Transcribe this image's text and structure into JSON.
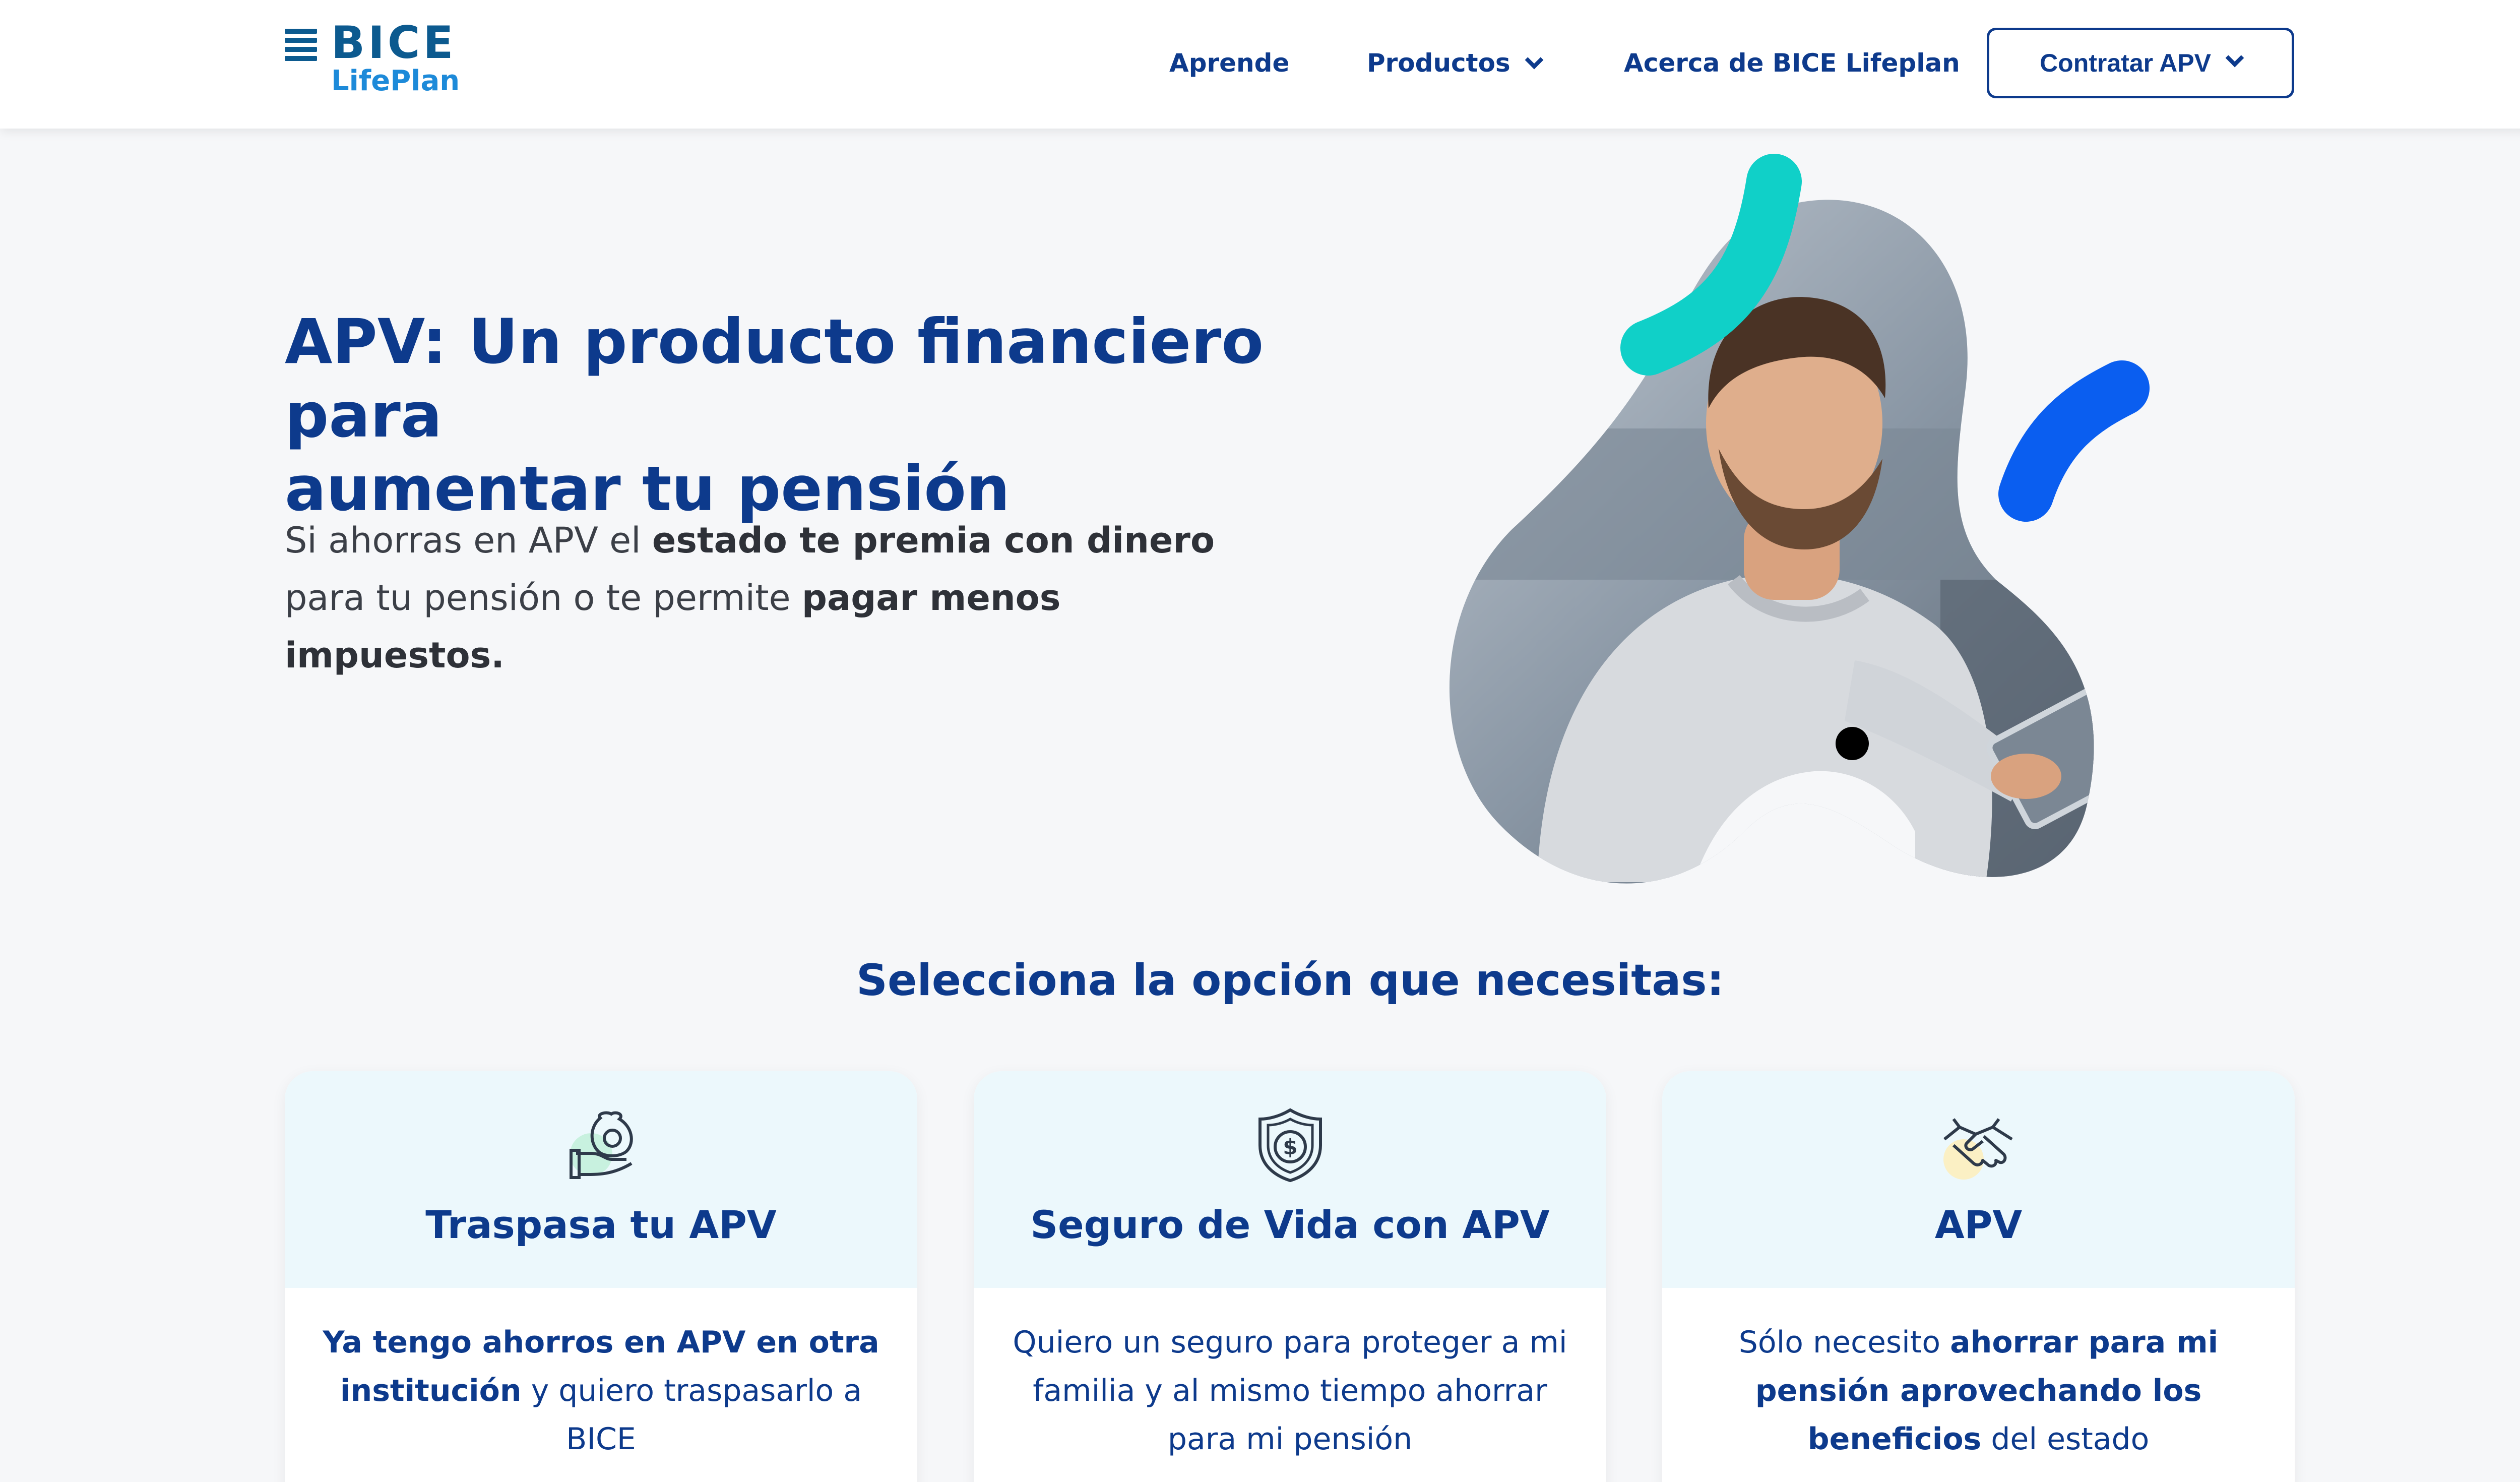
{
  "nav": {
    "logo_top": "BICE",
    "logo_bottom": "LifePlan",
    "links": [
      "Aprende",
      "Productos",
      "Acerca de BICE Lifeplan"
    ],
    "cta": "Contratar APV"
  },
  "hero": {
    "title_strong": "APV:",
    "title_light": " Un producto financiero para",
    "title_line2": "aumentar tu pensión",
    "text_1": "Si ahorras en APV el ",
    "text_b1": "estado te premia con dinero",
    "text_2": " para tu pensión o te permite ",
    "text_b2": "pagar menos impuestos."
  },
  "section": {
    "title": "Selecciona la opción que necesitas:"
  },
  "cards": [
    {
      "title": "Traspasa tu APV",
      "icon": "money-bag-hand-icon",
      "text_b": "Ya tengo ahorros en APV en otra institución",
      "text": " y quiero traspasarlo a BICE"
    },
    {
      "title": "Seguro de Vida con APV",
      "icon": "shield-dollar-icon",
      "text": "Quiero un seguro para proteger a mi familia y al mismo tiempo ahorrar para mi pensión"
    },
    {
      "title": "APV",
      "icon": "handshake-icon",
      "text_1": "Sólo necesito ",
      "text_b": "ahorrar para mi pensión aprovechando los beneficios",
      "text_2": " del estado"
    }
  ],
  "colors": {
    "primary": "#0d3a8c",
    "teal": "#10d0c8",
    "blue": "#0a5ef0",
    "card_top": "#ecf8fc"
  }
}
